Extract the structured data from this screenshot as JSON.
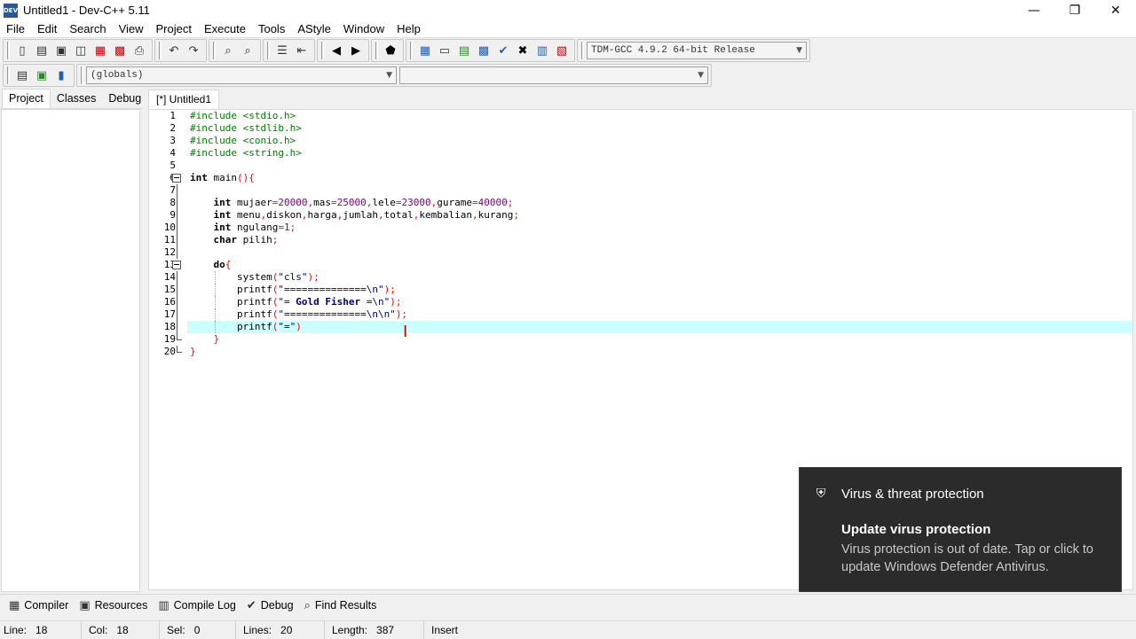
{
  "window": {
    "title": "Untitled1 - Dev-C++ 5.11",
    "icon_text": "DEV",
    "controls": {
      "minimize": "—",
      "maximize": "❐",
      "close": "✕"
    }
  },
  "menu": [
    "File",
    "Edit",
    "Search",
    "View",
    "Project",
    "Execute",
    "Tools",
    "AStyle",
    "Window",
    "Help"
  ],
  "toolbar": {
    "compiler_select": "TDM-GCC 4.9.2 64-bit Release",
    "scope_select": "(globals)",
    "member_select": ""
  },
  "left_panel": {
    "tabs": [
      "Project",
      "Classes",
      "Debug"
    ],
    "active_tab": "Project"
  },
  "editor": {
    "file_tab": "[*] Untitled1",
    "line_numbers": [
      "1",
      "2",
      "3",
      "4",
      "5",
      "6",
      "7",
      "8",
      "9",
      "10",
      "11",
      "12",
      "13",
      "14",
      "15",
      "16",
      "17",
      "18",
      "19",
      "20"
    ]
  },
  "code": {
    "l1": "#include <stdio.h>",
    "l2": "#include <stdlib.h>",
    "l3": "#include <conio.h>",
    "l4": "#include <string.h>"
  },
  "bottom_tabs": [
    "Compiler",
    "Resources",
    "Compile Log",
    "Debug",
    "Find Results"
  ],
  "status": {
    "line_label": "Line:",
    "line_value": "18",
    "col_label": "Col:",
    "col_value": "18",
    "sel_label": "Sel:",
    "sel_value": "0",
    "lines_label": "Lines:",
    "lines_value": "20",
    "length_label": "Length:",
    "length_value": "387",
    "mode": "Insert"
  },
  "toast": {
    "app": "Virus & threat protection",
    "title": "Update virus protection",
    "body": "Virus protection is out of date. Tap or click to update Windows Defender Antivirus."
  },
  "colors": {
    "current_line": "#ccffff",
    "preprocessor": "#008000",
    "number": "#800080",
    "symbol": "#ff0000",
    "string": "#000080",
    "toast_bg": "#2b2b2b"
  }
}
